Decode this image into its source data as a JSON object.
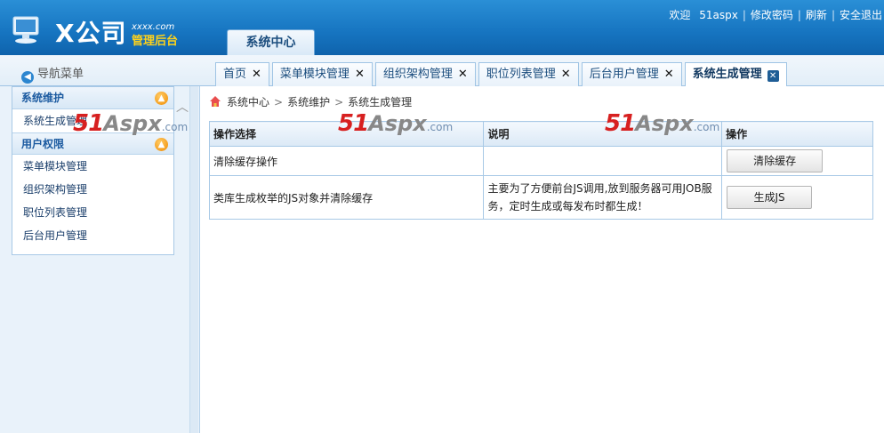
{
  "header": {
    "logo_text": "X公司",
    "logo_sub1": "xxxx.com",
    "logo_sub2": "管理后台",
    "main_tab": "系统中心",
    "links": {
      "welcome": "欢迎",
      "user": "51aspx",
      "change_password": "修改密码",
      "refresh": "刷新",
      "logout": "安全退出"
    }
  },
  "nav": {
    "title": "导航菜单"
  },
  "tabs": [
    {
      "label": "首页"
    },
    {
      "label": "菜单模块管理"
    },
    {
      "label": "组织架构管理"
    },
    {
      "label": "职位列表管理"
    },
    {
      "label": "后台用户管理"
    },
    {
      "label": "系统生成管理"
    }
  ],
  "sidebar": {
    "groups": [
      {
        "title": "系统维护",
        "items": [
          "系统生成管理"
        ]
      },
      {
        "title": "用户权限",
        "items": [
          "菜单模块管理",
          "组织架构管理",
          "职位列表管理",
          "后台用户管理"
        ]
      }
    ]
  },
  "breadcrumb": [
    "系统中心",
    "系统维护",
    "系统生成管理"
  ],
  "table": {
    "headers": [
      "操作选择",
      "说明",
      "操作"
    ],
    "rows": [
      {
        "name": "清除缓存操作",
        "desc": "",
        "button": "清除缓存"
      },
      {
        "name": "类库生成枚举的JS对象并清除缓存",
        "desc": "主要为了方便前台JS调用,放到服务器可用JOB服务，定时生成或每发布时都生成！",
        "button": "生成JS"
      }
    ]
  },
  "watermark": {
    "part_a": "51",
    "part_b": "Aspx",
    "part_c": ".com"
  },
  "colors": {
    "header": "#1674c0",
    "accent": "#1b5aa0",
    "watermark_red": "#d72020"
  }
}
